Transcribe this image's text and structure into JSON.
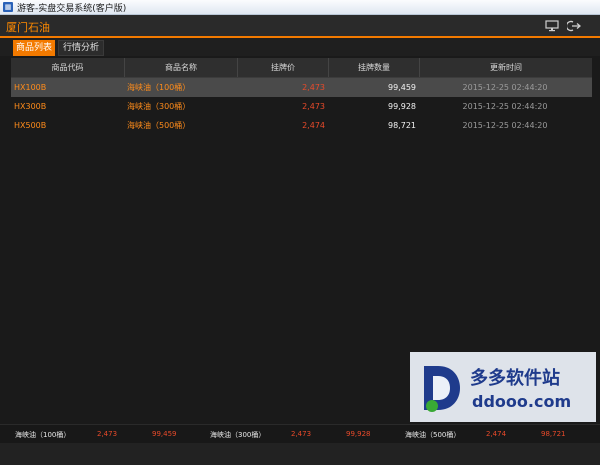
{
  "window": {
    "title": "游客-实盘交易系统(客户版)",
    "icon": "app-icon"
  },
  "header": {
    "brand": "厦门石油",
    "icons": [
      "monitor-icon",
      "exit-icon"
    ]
  },
  "tabs": [
    {
      "label": "商品列表",
      "active": true
    },
    {
      "label": "行情分析",
      "active": false
    }
  ],
  "table": {
    "columns": [
      "商品代码",
      "商品名称",
      "挂牌价",
      "挂牌数量",
      "更新时间"
    ],
    "rows": [
      {
        "code": "HX100B",
        "name": "海峡油（100桶）",
        "price": "2,473",
        "qty": "99,459",
        "time": "2015-12-25 02:44:20",
        "selected": true
      },
      {
        "code": "HX300B",
        "name": "海峡油（300桶）",
        "price": "2,473",
        "qty": "99,928",
        "time": "2015-12-25 02:44:20",
        "selected": false
      },
      {
        "code": "HX500B",
        "name": "海峡油（500桶）",
        "price": "2,474",
        "qty": "98,721",
        "time": "2015-12-25 02:44:20",
        "selected": false
      }
    ]
  },
  "ticker": [
    {
      "name": "海峡油（100桶）",
      "price": "2,473",
      "qty": "99,459"
    },
    {
      "name": "海峡油（300桶）",
      "price": "2,473",
      "qty": "99,928"
    },
    {
      "name": "海峡油（500桶）",
      "price": "2,474",
      "qty": "98,721"
    }
  ],
  "watermark": {
    "cn": "多多软件站",
    "en": "ddooo.com"
  },
  "colors": {
    "accent": "#f37a00",
    "price": "#e84a2a",
    "code": "#ff8c1a",
    "background": "#1a1a1a"
  }
}
